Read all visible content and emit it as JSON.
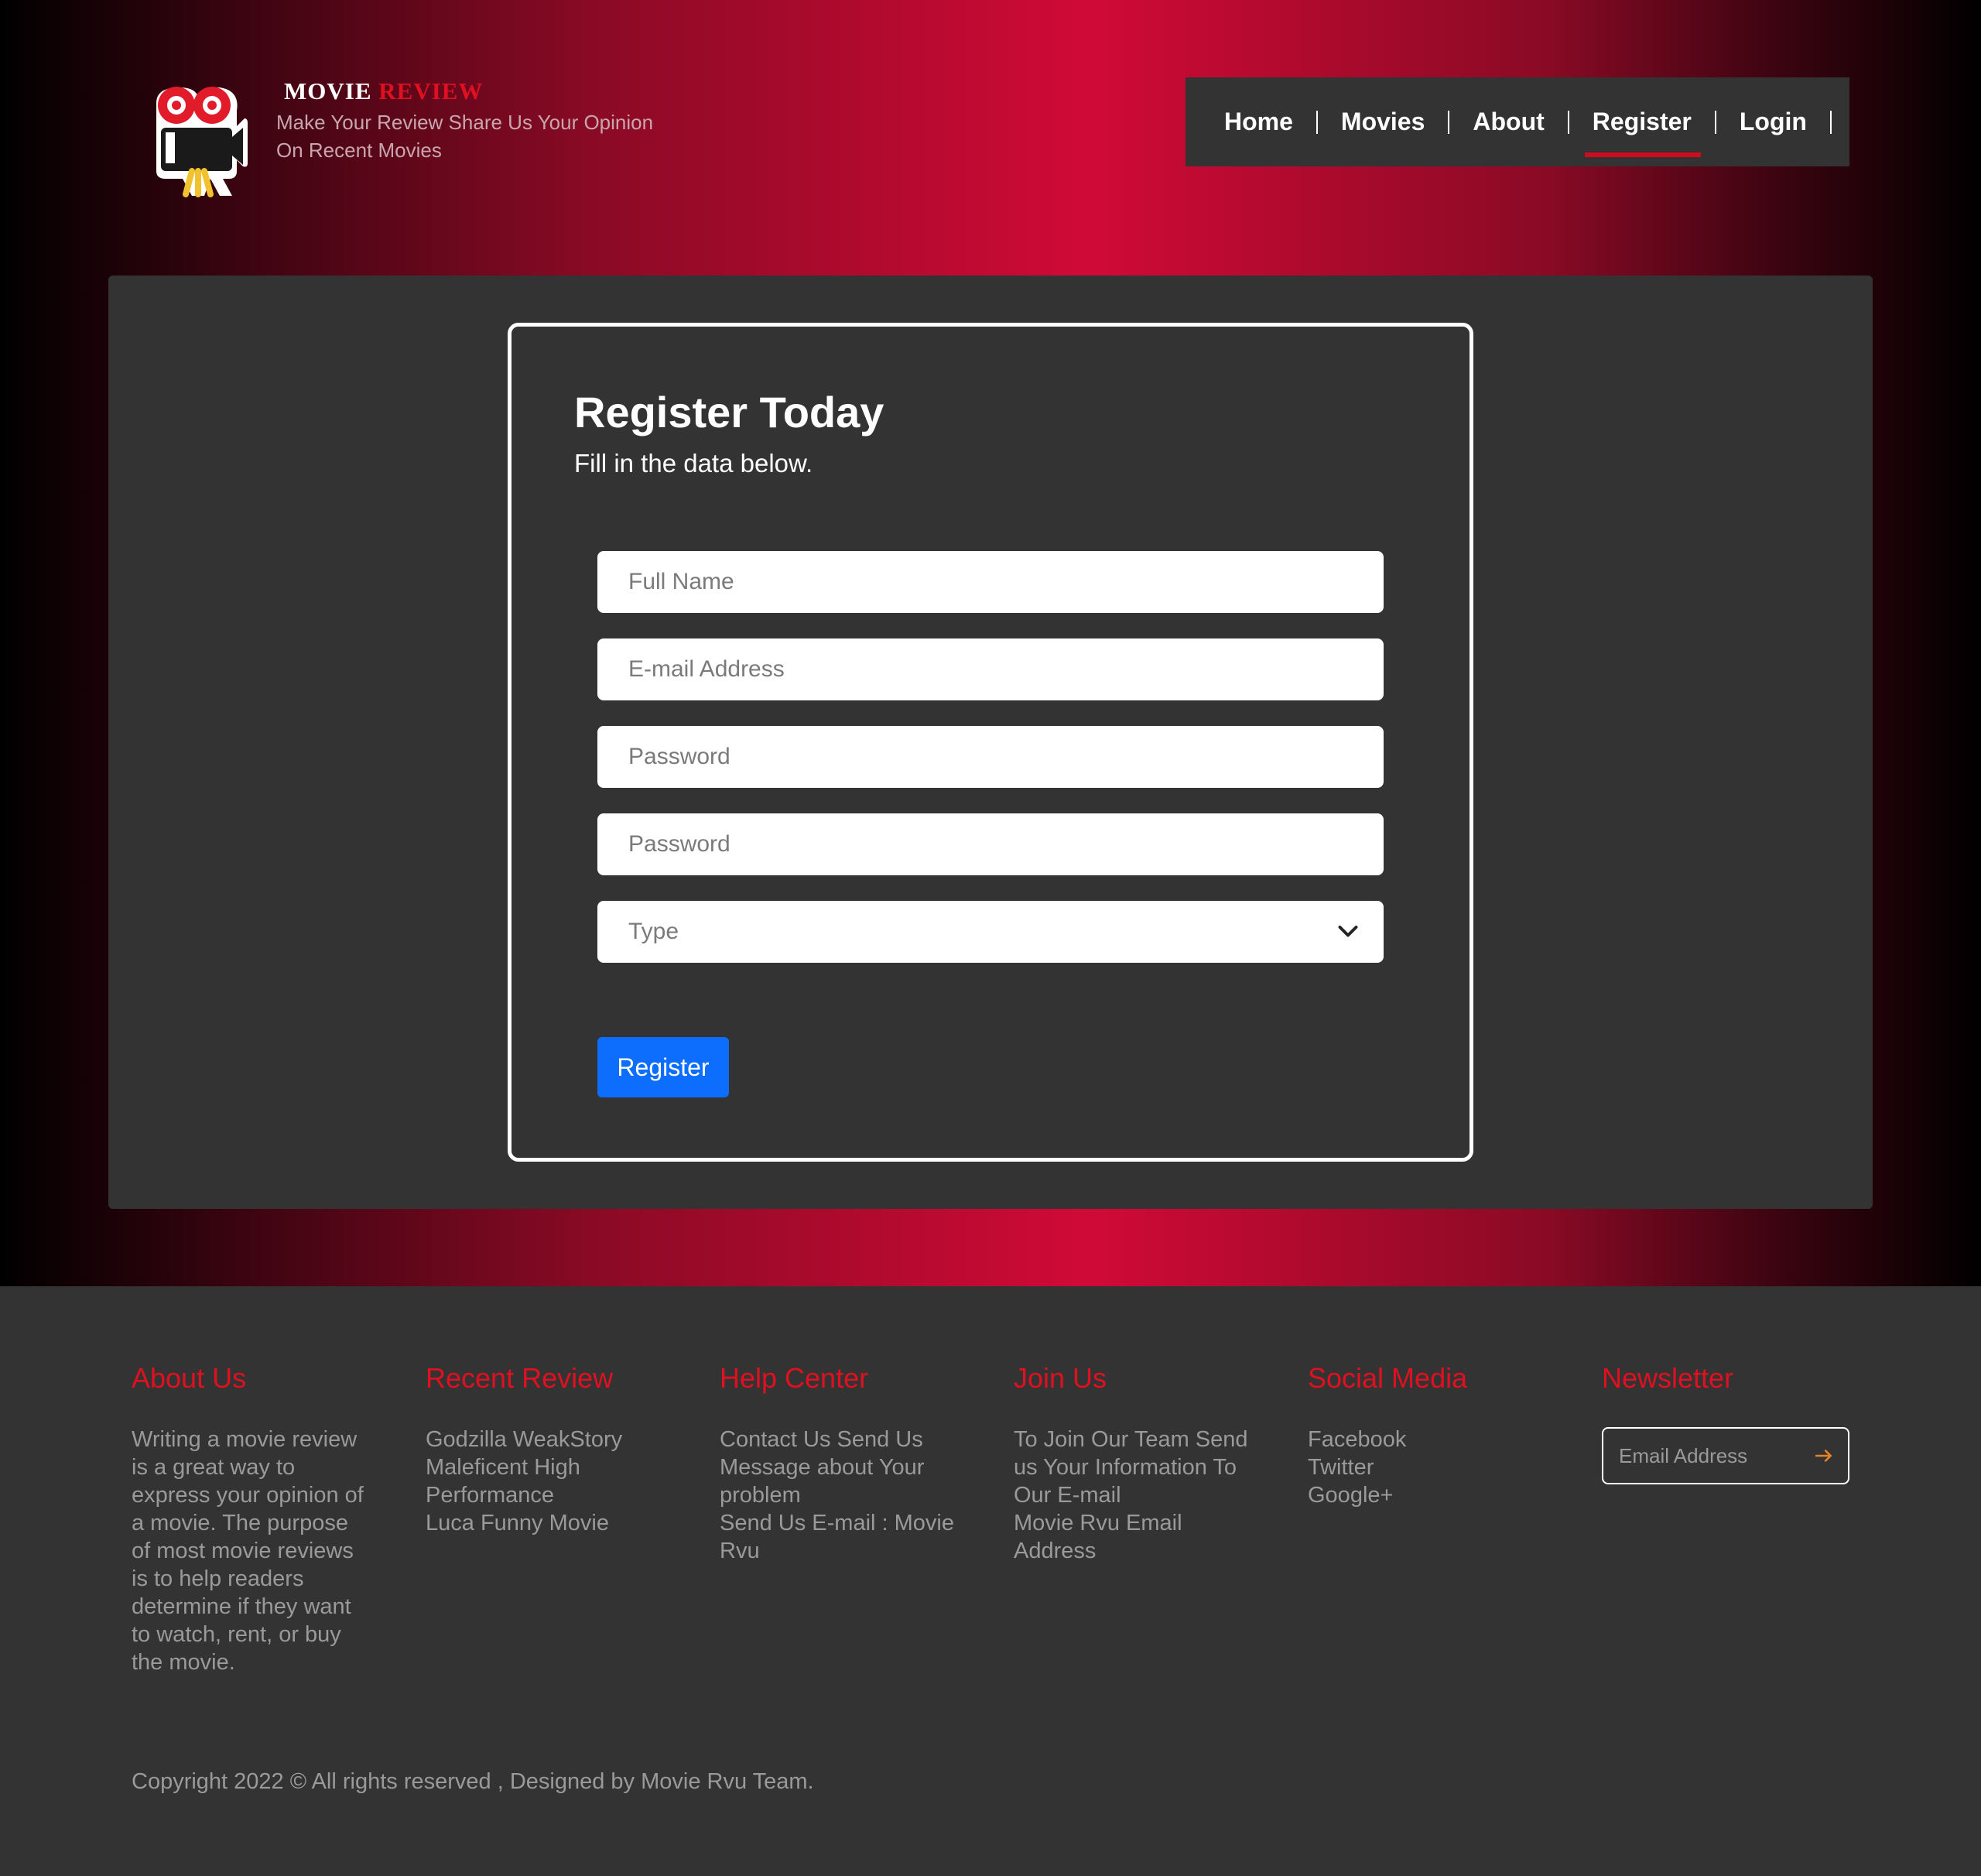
{
  "brand": {
    "title_white": "MOVIE",
    "title_red": "REVIEW",
    "tagline_line1": "Make Your Review Share Us Your Opinion",
    "tagline_line2": "On Recent Movies"
  },
  "nav": {
    "items": [
      {
        "label": "Home"
      },
      {
        "label": "Movies"
      },
      {
        "label": "About"
      },
      {
        "label": "Register"
      },
      {
        "label": "Login"
      }
    ],
    "active": "Register"
  },
  "form": {
    "title": "Register Today",
    "subtitle": "Fill in the data below.",
    "full_name_placeholder": "Full Name",
    "email_placeholder": "E-mail Address",
    "password_placeholder": "Password",
    "password2_placeholder": "Password",
    "type_placeholder": "Type",
    "submit_label": "Register"
  },
  "footer": {
    "about": {
      "heading": "About Us",
      "lines": [
        "Writing a movie review",
        "is a great way to",
        "express your opinion of",
        "a movie. The purpose",
        "of most movie reviews",
        "is to help readers",
        "determine if they want",
        "to watch, rent, or buy",
        "the movie."
      ]
    },
    "recent": {
      "heading": "Recent Review",
      "lines": [
        "Godzilla WeakStory",
        "Maleficent High",
        "Performance",
        "Luca Funny Movie"
      ]
    },
    "help": {
      "heading": "Help Center",
      "lines": [
        "Contact Us Send Us",
        "Message about Your",
        "problem",
        "Send Us E-mail : Movie",
        "Rvu"
      ]
    },
    "join": {
      "heading": "Join Us",
      "lines": [
        "To Join Our Team Send",
        "us Your Information To",
        "Our E-mail",
        "Movie Rvu Email",
        "Address"
      ]
    },
    "social": {
      "heading": "Social Media",
      "links": [
        "Facebook",
        "Twitter",
        "Google+"
      ]
    },
    "newsletter": {
      "heading": "Newsletter",
      "placeholder": "Email Address"
    },
    "copyright": "Copyright 2022 © All rights reserved , Designed by Movie Rvu Team."
  },
  "colors": {
    "accent_red": "#e01020",
    "primary_button": "#0d6efd",
    "panel": "#333333"
  },
  "icons": [
    "movie-camera-logo-icon",
    "chevron-down-icon",
    "arrow-right-icon"
  ]
}
